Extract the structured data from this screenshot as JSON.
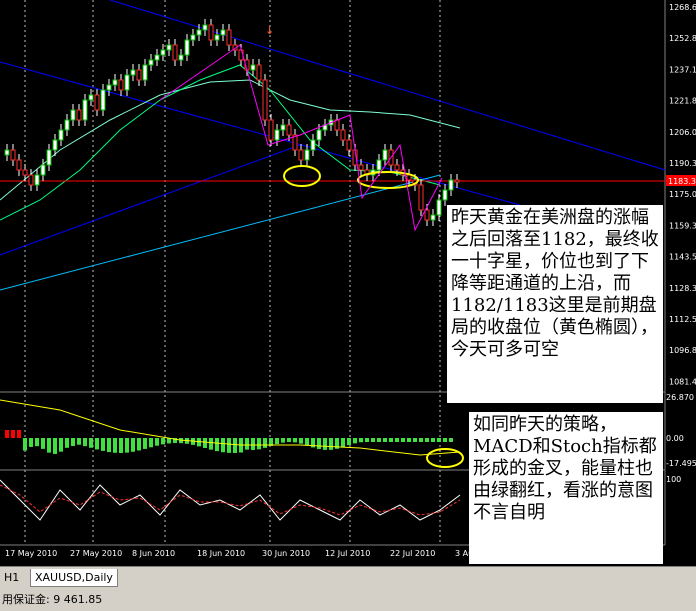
{
  "chart": {
    "colors": {
      "background": "#000000",
      "bull": "#00c000",
      "bear": "#ff3030",
      "channel": "#0000ff",
      "ma": "#7fffd4",
      "price_line": "#ff0000",
      "ellipse": "#ffff00",
      "arrow": "#ff00ff"
    },
    "price_axis": [
      "1268.65",
      "1252.80",
      "1237.10",
      "1221.85",
      "1206.00",
      "1190.30",
      "1175.00",
      "1159.30",
      "1143.55",
      "1128.30",
      "1112.55",
      "1096.80",
      "1081.40"
    ],
    "current_price": "1183.30",
    "date_axis": [
      "17 May 2010",
      "27 May 2010",
      "8 Jun 2010",
      "18 Jun 2010",
      "30 Jun 2010",
      "12 Jul 2010",
      "22 Jul 2010",
      "3 Au"
    ],
    "macd_axis": [
      "26.870",
      "0.00",
      "-17.495"
    ],
    "stoch_axis": [
      "100"
    ]
  },
  "annotations": {
    "note1": "昨天黄金在美洲盘的涨幅之后回落至1182，最终收一十字星，价位也到了下降等距通道的上沿，而1182/1183这里是前期盘局的收盘位（黄色椭圆），今天可多可空",
    "note2": "如同昨天的策略，MACD和Stoch指标都形成的金叉，能量柱也由绿翻红，看涨的意图不言自明"
  },
  "tabs": {
    "timeframe": "H1",
    "symbol": "XAUUSD,Daily"
  },
  "status": {
    "margin_text": "用保证金: 9 461.85"
  }
}
